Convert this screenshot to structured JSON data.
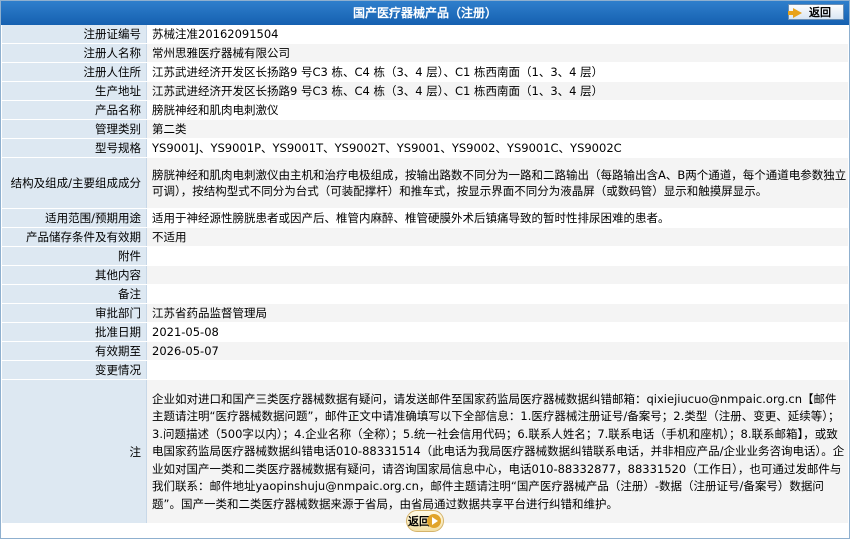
{
  "header": {
    "title": "国产医疗器械产品（注册）",
    "back_label": "返回"
  },
  "rows": [
    {
      "label": "注册证编号",
      "value": "苏械注准20162091504"
    },
    {
      "label": "注册人名称",
      "value": "常州思雅医疗器械有限公司"
    },
    {
      "label": "注册人住所",
      "value": "江苏武进经济开发区长扬路9 号C3 栋、C4 栋（3、4 层）、C1 栋西南面（1、3、4 层）"
    },
    {
      "label": "生产地址",
      "value": "江苏武进经济开发区长扬路9 号C3 栋、C4 栋（3、4 层）、C1 栋西南面（1、3、4 层）"
    },
    {
      "label": "产品名称",
      "value": "膀胱神经和肌肉电刺激仪"
    },
    {
      "label": "管理类别",
      "value": "第二类"
    },
    {
      "label": "型号规格",
      "value": "YS9001J、YS9001P、YS9001T、YS9002T、YS9001、YS9002、YS9001C、YS9002C"
    },
    {
      "label": "结构及组成/主要组成成分",
      "value": "膀胱神经和肌肉电刺激仪由主机和治疗电极组成，按输出路数不同分为一路和二路输出（每路输出含A、B两个通道，每个通道电参数独立可调），按结构型式不同分为台式（可装配撑杆）和推车式，按显示界面不同分为液晶屏（或数码管）显示和触摸屏显示。"
    },
    {
      "label": "适用范围/预期用途",
      "value": "适用于神经源性膀胱患者或因产后、椎管内麻醉、椎管硬膜外术后镇痛导致的暂时性排尿困难的患者。"
    },
    {
      "label": "产品储存条件及有效期",
      "value": "不适用"
    },
    {
      "label": "附件",
      "value": ""
    },
    {
      "label": "其他内容",
      "value": ""
    },
    {
      "label": "备注",
      "value": ""
    },
    {
      "label": "审批部门",
      "value": "江苏省药品监督管理局"
    },
    {
      "label": "批准日期",
      "value": "2021-05-08"
    },
    {
      "label": "有效期至",
      "value": "2026-05-07"
    },
    {
      "label": "变更情况",
      "value": ""
    },
    {
      "label": "注",
      "value": "企业如对进口和国产三类医疗器械数据有疑问，请发送邮件至国家药监局医疗器械数据纠错邮箱：qixiejiucuo@nmpaic.org.cn【邮件主题请注明“医疗器械数据问题”，邮件正文中请准确填写以下全部信息：1.医疗器械注册证号/备案号；2.类型（注册、变更、延续等）；3.问题描述（500字以内）；4.企业名称（全称）；5.统一社会信用代码；6.联系人姓名；7.联系电话（手机和座机）；8.联系邮箱】，或致电国家药监局医疗器械数据纠错电话010-88331514（此电话为我局医疗器械数据纠错联系电话，并非相应产品/企业业务咨询电话）。企业如对国产一类和二类医疗器械数据有疑问，请咨询国家局信息中心，电话010-88332877，88331520（工作日），也可通过发邮件与我们联系：邮件地址yaopinshuju@nmpaic.org.cn，邮件主题请注明“国产医疗器械产品（注册）-数据（注册证号/备案号）数据问题”。国产一类和二类医疗器械数据来源于省局，由省局通过数据共享平台进行纠错和维护。"
    }
  ],
  "footer": {
    "back_label": "返回"
  }
}
